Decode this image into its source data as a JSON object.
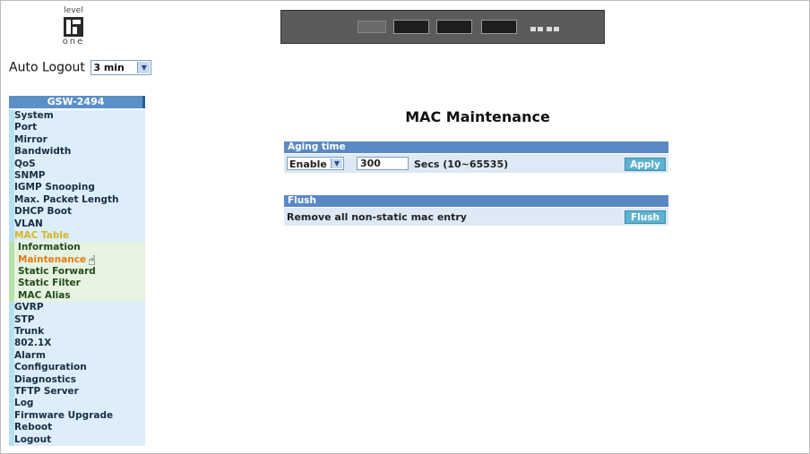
{
  "logo": {
    "top": "level",
    "bottom": "one"
  },
  "auto_logout": {
    "label": "Auto Logout",
    "value": "3 min"
  },
  "menu": {
    "header": "GSW-2494",
    "items": [
      {
        "label": "System",
        "type": "item"
      },
      {
        "label": "Port",
        "type": "item"
      },
      {
        "label": "Mirror",
        "type": "item"
      },
      {
        "label": "Bandwidth",
        "type": "item"
      },
      {
        "label": "QoS",
        "type": "item"
      },
      {
        "label": "SNMP",
        "type": "item"
      },
      {
        "label": "IGMP Snooping",
        "type": "item"
      },
      {
        "label": "Max. Packet Length",
        "type": "item"
      },
      {
        "label": "DHCP Boot",
        "type": "item"
      },
      {
        "label": "VLAN",
        "type": "item"
      },
      {
        "label": "MAC Table",
        "type": "active-parent"
      },
      {
        "label": "Information",
        "type": "sub"
      },
      {
        "label": "Maintenance",
        "type": "sub-active"
      },
      {
        "label": "Static Forward",
        "type": "sub"
      },
      {
        "label": "Static Filter",
        "type": "sub"
      },
      {
        "label": "MAC Alias",
        "type": "sub"
      },
      {
        "label": "GVRP",
        "type": "item"
      },
      {
        "label": "STP",
        "type": "item"
      },
      {
        "label": "Trunk",
        "type": "item"
      },
      {
        "label": "802.1X",
        "type": "item"
      },
      {
        "label": "Alarm",
        "type": "item"
      },
      {
        "label": "Configuration",
        "type": "item"
      },
      {
        "label": "Diagnostics",
        "type": "item"
      },
      {
        "label": "TFTP Server",
        "type": "item"
      },
      {
        "label": "Log",
        "type": "item"
      },
      {
        "label": "Firmware Upgrade",
        "type": "item"
      },
      {
        "label": "Reboot",
        "type": "item"
      },
      {
        "label": "Logout",
        "type": "item"
      }
    ]
  },
  "main": {
    "title": "MAC Maintenance",
    "aging": {
      "header": "Aging time",
      "select_value": "Enable",
      "input_value": "300",
      "unit_label": "Secs  (10~65535)",
      "apply_label": "Apply"
    },
    "flush": {
      "header": "Flush",
      "description": "Remove all non-static mac entry",
      "button_label": "Flush"
    }
  },
  "colors": {
    "menu_header": "#5b8fc7",
    "section_header": "#5a88c5",
    "button": "#5fb2cf",
    "active_item": "#e07b1a",
    "active_parent": "#d6b623"
  }
}
